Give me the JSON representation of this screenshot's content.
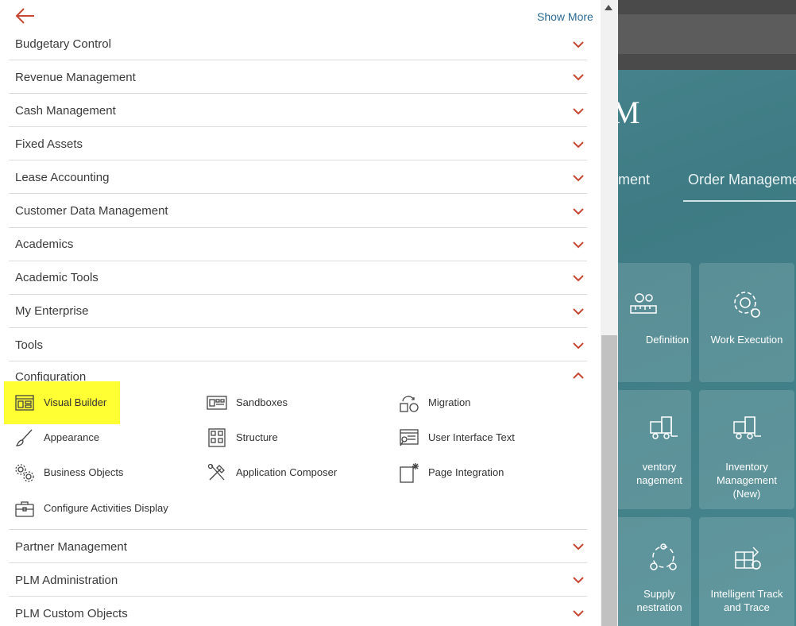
{
  "drawer": {
    "show_more": "Show More",
    "rows_top": [
      {
        "label": "Budgetary Control"
      },
      {
        "label": "Revenue Management"
      },
      {
        "label": "Cash Management"
      },
      {
        "label": "Fixed Assets"
      },
      {
        "label": "Lease Accounting"
      },
      {
        "label": "Customer Data Management"
      },
      {
        "label": "Academics"
      },
      {
        "label": "Academic Tools"
      },
      {
        "label": "My Enterprise"
      },
      {
        "label": "Tools"
      }
    ],
    "configuration": {
      "label": "Configuration",
      "expanded": true,
      "items": [
        {
          "label": "Visual Builder",
          "icon": "visual-builder-icon",
          "highlighted": true
        },
        {
          "label": "Sandboxes",
          "icon": "sandboxes-icon"
        },
        {
          "label": "Migration",
          "icon": "migration-icon"
        },
        {
          "label": "Appearance",
          "icon": "brush-icon"
        },
        {
          "label": "Structure",
          "icon": "structure-icon"
        },
        {
          "label": "User Interface Text",
          "icon": "user-interface-text-icon"
        },
        {
          "label": "Business Objects",
          "icon": "gears-icon"
        },
        {
          "label": "Application Composer",
          "icon": "tools-icon"
        },
        {
          "label": "Page Integration",
          "icon": "page-integration-icon"
        },
        {
          "label": "Configure Activities Display",
          "icon": "toolbox-icon"
        }
      ]
    },
    "rows_bottom": [
      {
        "label": "Partner Management"
      },
      {
        "label": "PLM Administration"
      },
      {
        "label": "PLM Custom Objects"
      }
    ]
  },
  "background": {
    "title_fragment": "M",
    "tabs": [
      "ment",
      "Order Manageme"
    ],
    "tiles": [
      {
        "label": "Definition",
        "icon": "ruler-gear-icon"
      },
      {
        "label": "Work Execution",
        "icon": "gear-icon"
      },
      {
        "label": "ventory\nnagement",
        "icon": "forklift-icon"
      },
      {
        "label": "Inventory\nManagement\n(New)",
        "icon": "forklift-icon"
      },
      {
        "label": "Supply\nnestration",
        "icon": "cycle-icon"
      },
      {
        "label": "Intelligent Track\nand Trace",
        "icon": "track-trace-icon"
      }
    ]
  },
  "colors": {
    "accent_red": "#c74634",
    "link_blue": "#2a6a94",
    "highlight_yellow": "#ffff33",
    "teal_background": "#3f7e87"
  }
}
